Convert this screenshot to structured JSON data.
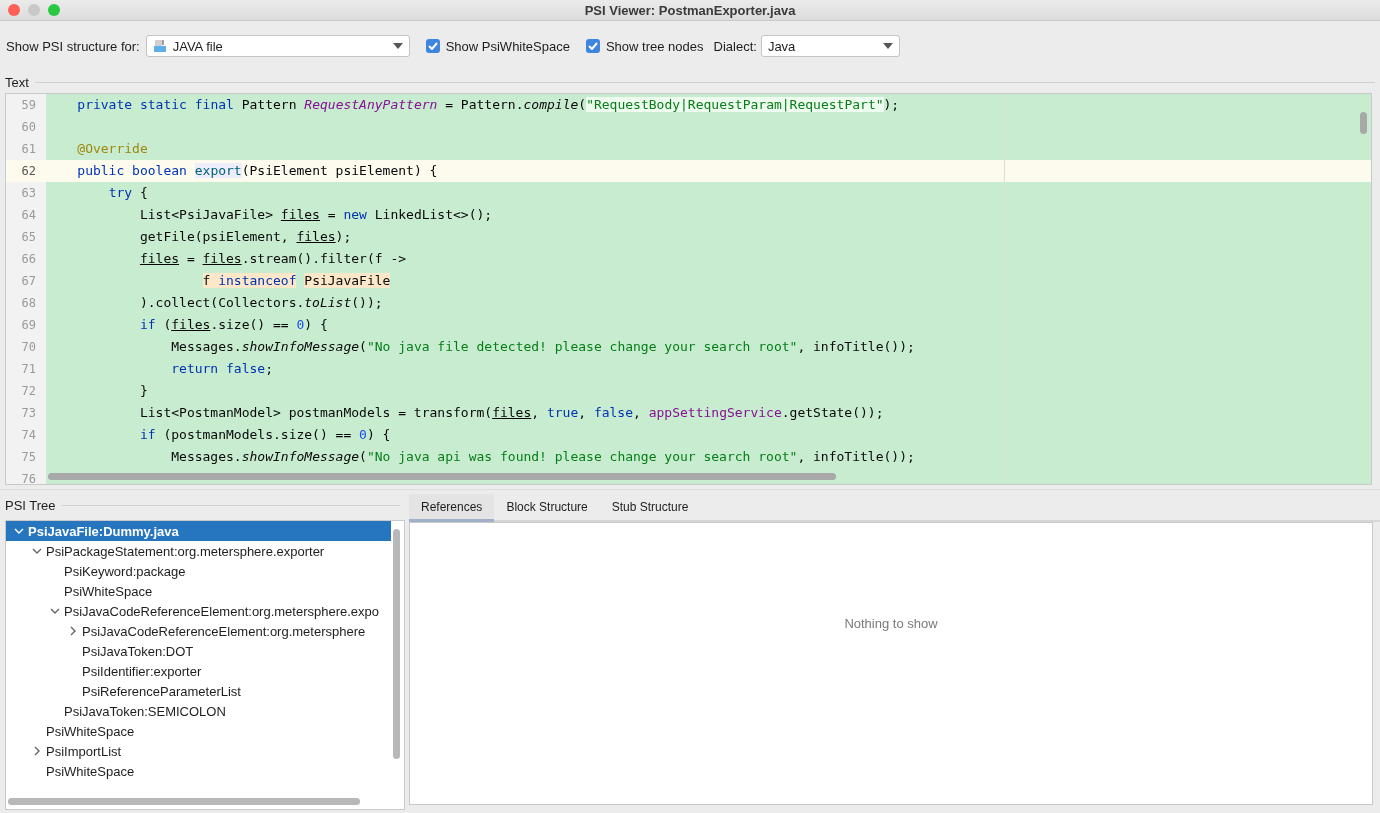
{
  "window": {
    "title": "PSI Viewer: PostmanExporter.java"
  },
  "toolbar": {
    "structure_label": "Show PSI structure for:",
    "structure_value": "JAVA file",
    "options": [
      {
        "label": "Show PsiWhiteSpace",
        "checked": true
      },
      {
        "label": "Show tree nodes",
        "checked": true
      }
    ],
    "dialect_label": "Dialect:",
    "dialect_value": "Java"
  },
  "text_section": {
    "title": "Text"
  },
  "editor": {
    "lines": [
      {
        "n": "59",
        "tokens": [
          {
            "t": "    private",
            "kind": "keyword"
          },
          {
            "t": " static",
            "kind": "keyword"
          },
          {
            "t": " final",
            "kind": "keyword"
          },
          {
            "t": " Pattern "
          },
          {
            "t": "RequestAnyPattern",
            "kind": "static_field"
          },
          {
            "t": " = Pattern."
          },
          {
            "t": "compile",
            "kind": "static_call"
          },
          {
            "t": "("
          },
          {
            "t": "\"RequestBody|RequestParam|RequestPart\"",
            "kind": "injected"
          },
          {
            "t": ");"
          }
        ]
      },
      {
        "n": "60"
      },
      {
        "n": "61",
        "tokens": [
          {
            "t": "    @Override",
            "kind": "annotation"
          }
        ]
      },
      {
        "n": "62",
        "caret": true,
        "tokens": [
          {
            "t": "    public",
            "kind": "keyword"
          },
          {
            "t": " boolean ",
            "kind": "keyword"
          },
          {
            "t": "export",
            "kind": "declaration",
            "usage": true
          },
          {
            "t": "(PsiElement psiElement) {"
          }
        ]
      },
      {
        "n": "63",
        "tokens": [
          {
            "t": "        try",
            "kind": "keyword"
          },
          {
            "t": " {"
          }
        ]
      },
      {
        "n": "64",
        "tokens": [
          {
            "t": "            List<PsiJavaFile> "
          },
          {
            "t": "files",
            "kind": "reassigned"
          },
          {
            "t": " = "
          },
          {
            "t": "new",
            "kind": "keyword"
          },
          {
            "t": " LinkedList<>();"
          }
        ]
      },
      {
        "n": "65",
        "tokens": [
          {
            "t": "            getFile(psiElement, "
          },
          {
            "t": "files",
            "kind": "reassigned"
          },
          {
            "t": ");"
          }
        ]
      },
      {
        "n": "66",
        "tokens": [
          {
            "t": "            files",
            "kind": "reassigned"
          },
          {
            "t": " = "
          },
          {
            "t": "files",
            "kind": "reassigned"
          },
          {
            "t": ".stream().filter(f ->"
          }
        ]
      },
      {
        "n": "67",
        "tokens": [
          {
            "t": "                    f ",
            "match": true
          },
          {
            "t": "instanceof",
            "kind": "keyword",
            "match": true
          },
          {
            "t": " PsiJavaFile",
            "match": true
          }
        ]
      },
      {
        "n": "68",
        "tokens": [
          {
            "t": "            ).collect(Collectors."
          },
          {
            "t": "toList",
            "kind": "static_call"
          },
          {
            "t": "());"
          }
        ]
      },
      {
        "n": "69",
        "tokens": [
          {
            "t": "            if",
            "kind": "keyword"
          },
          {
            "t": " ("
          },
          {
            "t": "files",
            "kind": "reassigned"
          },
          {
            "t": ".size() == "
          },
          {
            "t": "0",
            "kind": "number"
          },
          {
            "t": ") {"
          }
        ]
      },
      {
        "n": "70",
        "tokens": [
          {
            "t": "                Messages."
          },
          {
            "t": "showInfoMessage",
            "kind": "static_call"
          },
          {
            "t": "("
          },
          {
            "t": "\"No java file detected! please change your search root\"",
            "kind": "string"
          },
          {
            "t": ", infoTitle());"
          }
        ]
      },
      {
        "n": "71",
        "tokens": [
          {
            "t": "                return",
            "kind": "keyword"
          },
          {
            "t": " false",
            "kind": "keyword"
          },
          {
            "t": ";"
          }
        ]
      },
      {
        "n": "72",
        "tokens": [
          {
            "t": "            }"
          }
        ]
      },
      {
        "n": "73",
        "tokens": [
          {
            "t": "            List<PostmanModel> postmanModels = transform("
          },
          {
            "t": "files",
            "kind": "reassigned"
          },
          {
            "t": ", "
          },
          {
            "t": "true",
            "kind": "keyword"
          },
          {
            "t": ", "
          },
          {
            "t": "false",
            "kind": "keyword"
          },
          {
            "t": ", "
          },
          {
            "t": "appSettingService",
            "kind": "field"
          },
          {
            "t": ".getState());"
          }
        ]
      },
      {
        "n": "74",
        "tokens": [
          {
            "t": "            if",
            "kind": "keyword"
          },
          {
            "t": " (postmanModels.size() == "
          },
          {
            "t": "0",
            "kind": "number"
          },
          {
            "t": ") {"
          }
        ]
      },
      {
        "n": "75",
        "tokens": [
          {
            "t": "                Messages."
          },
          {
            "t": "showInfoMessage",
            "kind": "static_call"
          },
          {
            "t": "("
          },
          {
            "t": "\"No java api was found! please change your search root\"",
            "kind": "string"
          },
          {
            "t": ", infoTitle());"
          }
        ]
      },
      {
        "n": "76"
      }
    ]
  },
  "psi_tree": {
    "title": "PSI Tree",
    "items": [
      {
        "label": "PsiJavaFile:Dummy.java",
        "selected": true,
        "expanded": true,
        "children": [
          {
            "label": "PsiPackageStatement:org.metersphere.exporter",
            "selected": false,
            "expanded": true,
            "children": [
              {
                "label": "PsiKeyword:package",
                "selected": false
              },
              {
                "label": "PsiWhiteSpace",
                "selected": false
              },
              {
                "label": "PsiJavaCodeReferenceElement:org.metersphere.expo",
                "selected": false,
                "expanded": true,
                "children": [
                  {
                    "label": "PsiJavaCodeReferenceElement:org.metersphere",
                    "selected": false,
                    "expanded": false
                  },
                  {
                    "label": "PsiJavaToken:DOT",
                    "selected": false
                  },
                  {
                    "label": "PsiIdentifier:exporter",
                    "selected": false
                  },
                  {
                    "label": "PsiReferenceParameterList",
                    "selected": false
                  }
                ]
              },
              {
                "label": "PsiJavaToken:SEMICOLON",
                "selected": false
              }
            ]
          },
          {
            "label": "PsiWhiteSpace",
            "selected": false
          },
          {
            "label": "PsiImportList",
            "selected": false,
            "expanded": false
          },
          {
            "label": "PsiWhiteSpace",
            "selected": false
          }
        ]
      }
    ]
  },
  "tabs": [
    {
      "label": "References",
      "selected": true
    },
    {
      "label": "Block Structure",
      "selected": false
    },
    {
      "label": "Stub Structure",
      "selected": false
    }
  ],
  "details": {
    "empty_text": "Nothing to show"
  }
}
